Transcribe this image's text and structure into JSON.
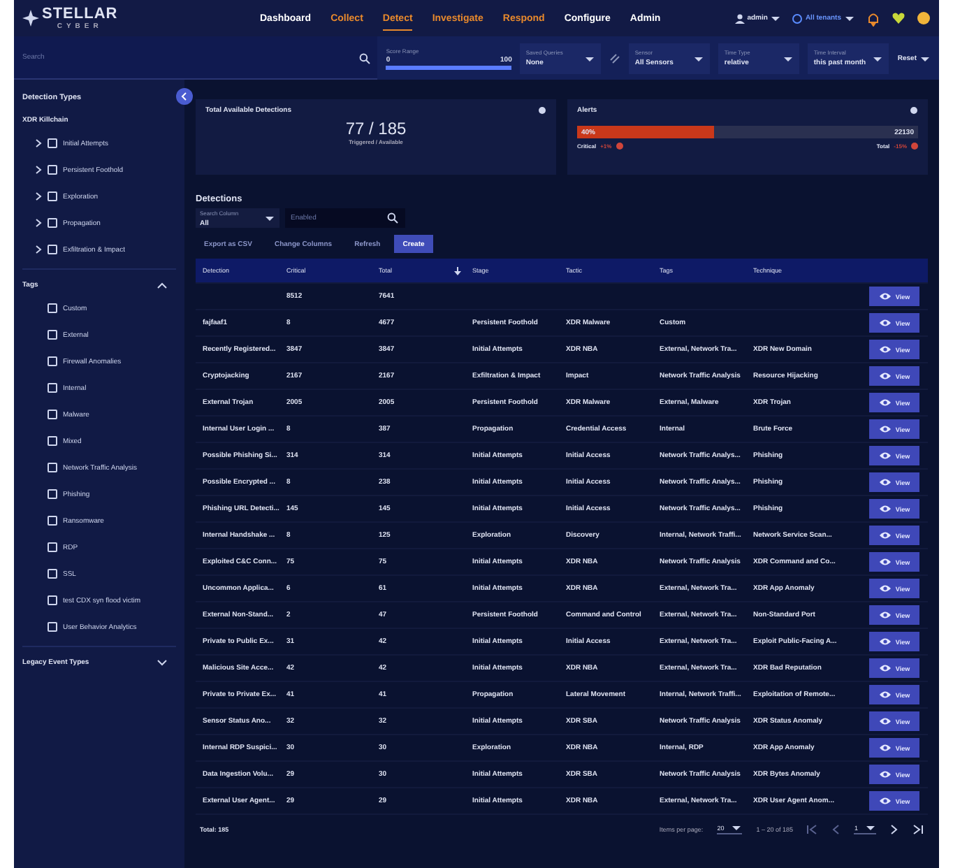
{
  "nav": {
    "logo": "STELLAR",
    "logo_sub": "CYBER",
    "items": [
      {
        "label": "Dashboard",
        "color": "#ffffff",
        "selected": false
      },
      {
        "label": "Collect",
        "color": "#e8892c",
        "selected": false
      },
      {
        "label": "Detect",
        "color": "#e8892c",
        "selected": true
      },
      {
        "label": "Investigate",
        "color": "#e8892c",
        "selected": false
      },
      {
        "label": "Respond",
        "color": "#e8892c",
        "selected": false
      },
      {
        "label": "Configure",
        "color": "#ffffff",
        "selected": false
      },
      {
        "label": "Admin",
        "color": "#ffffff",
        "selected": false
      }
    ],
    "user": "admin",
    "tenant": "All tenants"
  },
  "filter_bar": {
    "search": {
      "placeholder": "Search"
    },
    "score_range": {
      "label": "Score Range",
      "min": "0",
      "max": "100"
    },
    "selects": [
      {
        "label": "Saved Queries",
        "value": "None"
      },
      {
        "label": "Sensor",
        "value": "All Sensors"
      },
      {
        "label": "Time Type",
        "value": "relative"
      },
      {
        "label": "Time Interval",
        "value": "this past month"
      }
    ],
    "reset": "Reset"
  },
  "sidebar": {
    "title": "Detection Types",
    "sections": [
      {
        "title": "XDR Killchain",
        "items": [
          {
            "label": "Initial Attempts",
            "checked": false,
            "expanded": false
          },
          {
            "label": "Persistent Foothold",
            "checked": false,
            "expanded": false
          },
          {
            "label": "Exploration",
            "checked": false,
            "expanded": false
          },
          {
            "label": "Propagation",
            "checked": false,
            "expanded": false
          },
          {
            "label": "Exfiltration & Impact",
            "checked": false,
            "expanded": false
          }
        ]
      },
      {
        "title": "Tags",
        "expanded": true,
        "items": [
          {
            "label": "Custom",
            "checked": false
          },
          {
            "label": "External",
            "checked": false
          },
          {
            "label": "Firewall Anomalies",
            "checked": false
          },
          {
            "label": "Internal",
            "checked": false
          },
          {
            "label": "Malware",
            "checked": false
          },
          {
            "label": "Mixed",
            "checked": false
          },
          {
            "label": "Network Traffic Analysis",
            "checked": false
          },
          {
            "label": "Phishing",
            "checked": false
          },
          {
            "label": "Ransomware",
            "checked": false
          },
          {
            "label": "RDP",
            "checked": false
          },
          {
            "label": "SSL",
            "checked": false
          },
          {
            "label": "test CDX syn flood victim",
            "checked": false
          },
          {
            "label": "User Behavior Analytics",
            "checked": false
          }
        ]
      },
      {
        "title": "Legacy Event Types",
        "expanded": false
      }
    ]
  },
  "summary_card": {
    "title": "Total Available Detections",
    "value": "77 / 185",
    "caption": "Triggered / Available"
  },
  "alerts_card": {
    "title": "Alerts",
    "bar_label": "40%",
    "level": 0.4,
    "total": "22130",
    "critical_label": "Critical",
    "critical_change": "+1%",
    "total_label": "Total",
    "total_change": "-15%"
  },
  "detections": {
    "title": "Detections",
    "search_column": {
      "label": "Search Column",
      "value": "All"
    },
    "search": {
      "placeholder": "Enabled"
    },
    "buttons": [
      {
        "label": "Export as CSV",
        "primary": false
      },
      {
        "label": "Change Columns",
        "primary": false
      },
      {
        "label": "Refresh",
        "primary": false
      },
      {
        "label": "Create",
        "primary": true
      }
    ],
    "table": {
      "columns": [
        {
          "label": "Detection",
          "sorted": false
        },
        {
          "label": "Critical",
          "sorted": false
        },
        {
          "label": "Total",
          "sorted": true
        },
        {
          "label": "Stage",
          "sorted": false
        },
        {
          "label": "Tactic",
          "sorted": false
        },
        {
          "label": "Tags",
          "sorted": false
        },
        {
          "label": "Technique",
          "sorted": false
        }
      ],
      "rows": [
        {
          "cells": [
            "",
            "8512",
            "7641",
            "",
            "",
            "",
            ""
          ],
          "action": "View"
        },
        {
          "cells": [
            "fajfaaf1",
            "8",
            "4677",
            "Persistent Foothold",
            "XDR Malware",
            "Custom",
            ""
          ],
          "action": "View"
        },
        {
          "cells": [
            "Recently Registered...",
            "3847",
            "3847",
            "Initial Attempts",
            "XDR NBA",
            "External, Network Tra...",
            "XDR New Domain"
          ],
          "action": "View"
        },
        {
          "cells": [
            "Cryptojacking",
            "2167",
            "2167",
            "Exfiltration & Impact",
            "Impact",
            "Network Traffic Analysis",
            "Resource Hijacking"
          ],
          "action": "View"
        },
        {
          "cells": [
            "External Trojan",
            "2005",
            "2005",
            "Persistent Foothold",
            "XDR Malware",
            "External, Malware",
            "XDR Trojan"
          ],
          "action": "View"
        },
        {
          "cells": [
            "Internal User Login ...",
            "8",
            "387",
            "Propagation",
            "Credential Access",
            "Internal",
            "Brute Force"
          ],
          "action": "View"
        },
        {
          "cells": [
            "Possible Phishing Si...",
            "314",
            "314",
            "Initial Attempts",
            "Initial Access",
            "Network Traffic Analys...",
            "Phishing"
          ],
          "action": "View"
        },
        {
          "cells": [
            "Possible Encrypted ...",
            "8",
            "238",
            "Initial Attempts",
            "Initial Access",
            "Network Traffic Analys...",
            "Phishing"
          ],
          "action": "View"
        },
        {
          "cells": [
            "Phishing URL Detecti...",
            "145",
            "145",
            "Initial Attempts",
            "Initial Access",
            "Network Traffic Analys...",
            "Phishing"
          ],
          "action": "View"
        },
        {
          "cells": [
            "Internal Handshake ...",
            "8",
            "125",
            "Exploration",
            "Discovery",
            "Internal, Network Traffi...",
            "Network Service Scan..."
          ],
          "action": "View"
        },
        {
          "cells": [
            "Exploited C&C Conn...",
            "75",
            "75",
            "Initial Attempts",
            "XDR NBA",
            "Network Traffic Analysis",
            "XDR Command and Co..."
          ],
          "action": "View"
        },
        {
          "cells": [
            "Uncommon Applica...",
            "6",
            "61",
            "Initial Attempts",
            "XDR NBA",
            "External, Network Tra...",
            "XDR App Anomaly"
          ],
          "action": "View"
        },
        {
          "cells": [
            "External Non-Stand...",
            "2",
            "47",
            "Persistent Foothold",
            "Command and Control",
            "External, Network Tra...",
            "Non-Standard Port"
          ],
          "action": "View"
        },
        {
          "cells": [
            "Private to Public Ex...",
            "31",
            "42",
            "Initial Attempts",
            "Initial Access",
            "External, Network Tra...",
            "Exploit Public-Facing A..."
          ],
          "action": "View"
        },
        {
          "cells": [
            "Malicious Site Acce...",
            "42",
            "42",
            "Initial Attempts",
            "XDR NBA",
            "External, Network Tra...",
            "XDR Bad Reputation"
          ],
          "action": "View"
        },
        {
          "cells": [
            "Private to Private Ex...",
            "41",
            "41",
            "Propagation",
            "Lateral Movement",
            "Internal, Network Traffi...",
            "Exploitation of Remote..."
          ],
          "action": "View"
        },
        {
          "cells": [
            "Sensor Status Ano...",
            "32",
            "32",
            "Initial Attempts",
            "XDR SBA",
            "Network Traffic Analysis",
            "XDR Status Anomaly"
          ],
          "action": "View"
        },
        {
          "cells": [
            "Internal RDP Suspici...",
            "30",
            "30",
            "Exploration",
            "XDR NBA",
            "Internal, RDP",
            "XDR App Anomaly"
          ],
          "action": "View"
        },
        {
          "cells": [
            "Data Ingestion Volu...",
            "29",
            "30",
            "Initial Attempts",
            "XDR SBA",
            "Network Traffic Analysis",
            "XDR Bytes Anomaly"
          ],
          "action": "View"
        },
        {
          "cells": [
            "External User Agent...",
            "29",
            "29",
            "Initial Attempts",
            "XDR NBA",
            "External, Network Tra...",
            "XDR User Agent Anom..."
          ],
          "action": "View"
        }
      ]
    },
    "footer": {
      "total": "Total: 185",
      "per_page_label": "Items per page:",
      "per_page": "20",
      "range": "1 – 20 of 185",
      "page": "1"
    }
  }
}
